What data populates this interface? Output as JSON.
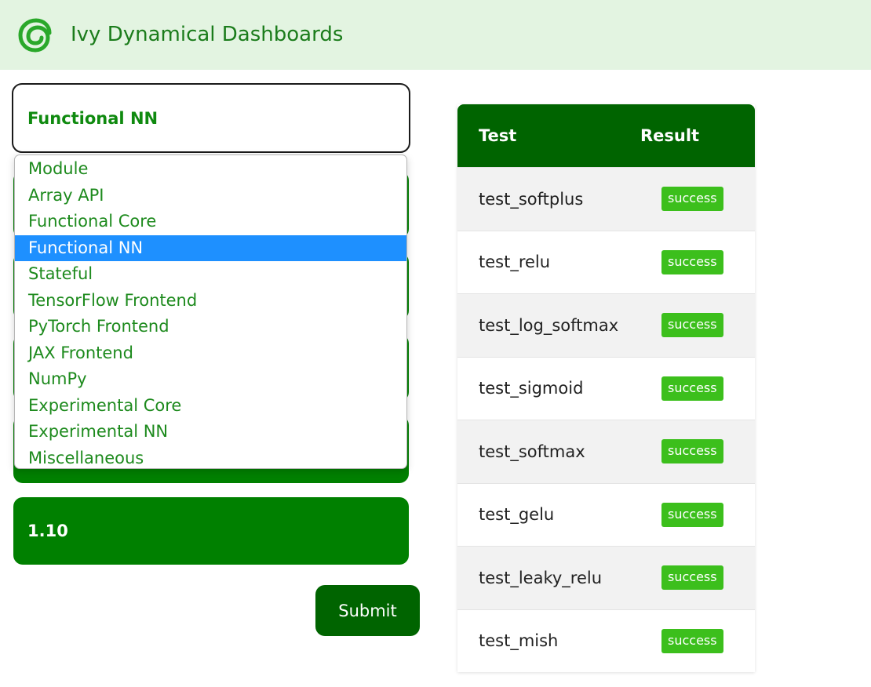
{
  "header": {
    "title": "Ivy Dynamical Dashboards",
    "logo_icon": "ivy-spiral-icon",
    "accent": "#1b7c1b",
    "background": "#e3f4e1"
  },
  "form": {
    "selected_submodule": "Functional NN",
    "version": "1.10",
    "submit_label": "Submit",
    "field_color": "#008000"
  },
  "dropdown": {
    "options": [
      "Module",
      "Array API",
      "Functional Core",
      "Functional NN",
      "Stateful",
      "TensorFlow Frontend",
      "PyTorch Frontend",
      "JAX Frontend",
      "NumPy",
      "Experimental Core",
      "Experimental NN",
      "Miscellaneous"
    ],
    "highlighted": "Functional NN",
    "highlight_color": "#1e90ff"
  },
  "results": {
    "header": {
      "test": "Test",
      "result": "Result"
    },
    "rows": [
      {
        "test": "test_softplus",
        "result": "success"
      },
      {
        "test": "test_relu",
        "result": "success"
      },
      {
        "test": "test_log_softmax",
        "result": "success"
      },
      {
        "test": "test_sigmoid",
        "result": "success"
      },
      {
        "test": "test_softmax",
        "result": "success"
      },
      {
        "test": "test_gelu",
        "result": "success"
      },
      {
        "test": "test_leaky_relu",
        "result": "success"
      },
      {
        "test": "test_mish",
        "result": "success"
      }
    ],
    "success_color": "#3cbf1c",
    "header_color": "#006400"
  }
}
